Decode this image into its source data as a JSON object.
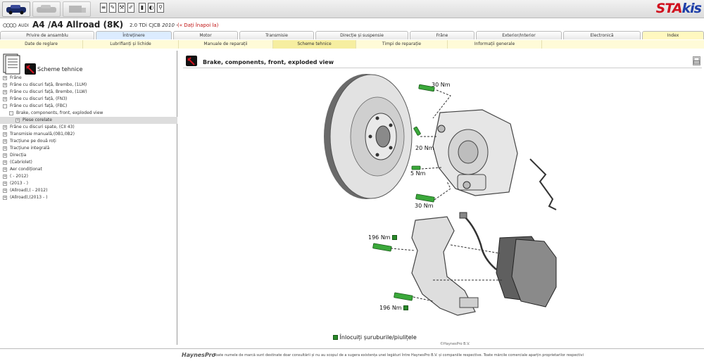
{
  "vehicle": {
    "make": "AUDI",
    "model": "A4  /A4 Allroad (8K)",
    "engine": "2.0 TDi CJCB",
    "year": "2010 -",
    "back_link": "(« Dați înapoi la)"
  },
  "brand": {
    "part_a": "STA",
    "part_b": "kis"
  },
  "main_tabs": [
    {
      "label": "Privire de ansamblu",
      "active": false
    },
    {
      "label": "Întreținere",
      "active": true
    },
    {
      "label": "Motor",
      "active": false
    },
    {
      "label": "Transmisie",
      "active": false
    },
    {
      "label": "Direcție și suspensie",
      "active": false
    },
    {
      "label": "Frâne",
      "active": false
    },
    {
      "label": "Exterior/Interior",
      "active": false
    },
    {
      "label": "Electronică",
      "active": false
    },
    {
      "label": "Index",
      "active": false
    }
  ],
  "sub_tabs": [
    {
      "label": "Date de reglare"
    },
    {
      "label": "Lubrifianți și lichide"
    },
    {
      "label": "Manuale de reparații"
    },
    {
      "label": "Scheme tehnice",
      "active": true
    },
    {
      "label": "Timpi de reparație"
    },
    {
      "label": "Informații generale"
    }
  ],
  "sidebar": {
    "title": "Scheme tehnice",
    "items": [
      {
        "label": "Frâne",
        "level": 0,
        "sign": "+"
      },
      {
        "label": "Frâne cu discuri față, Brembo, (1LM)",
        "level": 0,
        "sign": "+"
      },
      {
        "label": "Frâne cu discuri față, Brembo, (1LW)",
        "level": 0,
        "sign": "+"
      },
      {
        "label": "Frâne cu discuri față, (FN3)",
        "level": 0,
        "sign": "+"
      },
      {
        "label": "Frâne cu discuri față, (FBC)",
        "level": 0,
        "sign": "-"
      },
      {
        "label": "Brake, components, front, exploded view",
        "level": 1,
        "sign": "-"
      },
      {
        "label": "Piese corelate",
        "level": 2,
        "sign": "+",
        "selected": true
      },
      {
        "label": "Frâne cu discuri spate, (CII 43)",
        "level": 0,
        "sign": "+"
      },
      {
        "label": "Transmisie manuală,(0B1,0B2)",
        "level": 0,
        "sign": "+"
      },
      {
        "label": "Tracțiune pe două roți",
        "level": 0,
        "sign": "+"
      },
      {
        "label": "Tracțiune integrală",
        "level": 0,
        "sign": "+"
      },
      {
        "label": "Direcția",
        "level": 0,
        "sign": "+"
      },
      {
        "label": "(Cabriolet)",
        "level": 0,
        "sign": "+"
      },
      {
        "label": "Aer condiționat",
        "level": 0,
        "sign": "+"
      },
      {
        "label": "( - 2012)",
        "level": 0,
        "sign": "+"
      },
      {
        "label": "(2013 - )",
        "level": 0,
        "sign": "+"
      },
      {
        "label": "(Allroad),( - 2012)",
        "level": 0,
        "sign": "+"
      },
      {
        "label": "(Allroad),(2013 - )",
        "level": 0,
        "sign": "+"
      }
    ]
  },
  "diagram": {
    "title": "Brake, components, front, exploded view",
    "torques": [
      "30 Nm",
      "20 Nm",
      "5 Nm",
      "30 Nm",
      "196 Nm",
      "196 Nm"
    ],
    "legend": "Înlocuiți șuruburile/piulițele",
    "copyright": "©HaynesPro B.V."
  },
  "footer": {
    "brand": "HaynesPro",
    "text": "Toate numele de marcă sunt destinate doar consultării și nu au scopul de a sugera existența unei legături între HaynesPro B.V. și companiile respective. Toate mărcile comerciale aparțin proprietarilor respectivi"
  },
  "colors": {
    "accent": "#d0101e",
    "brand_blue": "#1e3fa8",
    "bolt_green": "#2a8a2a",
    "tab_active": "#dcecff",
    "subtab_bg": "#fffbd8"
  }
}
